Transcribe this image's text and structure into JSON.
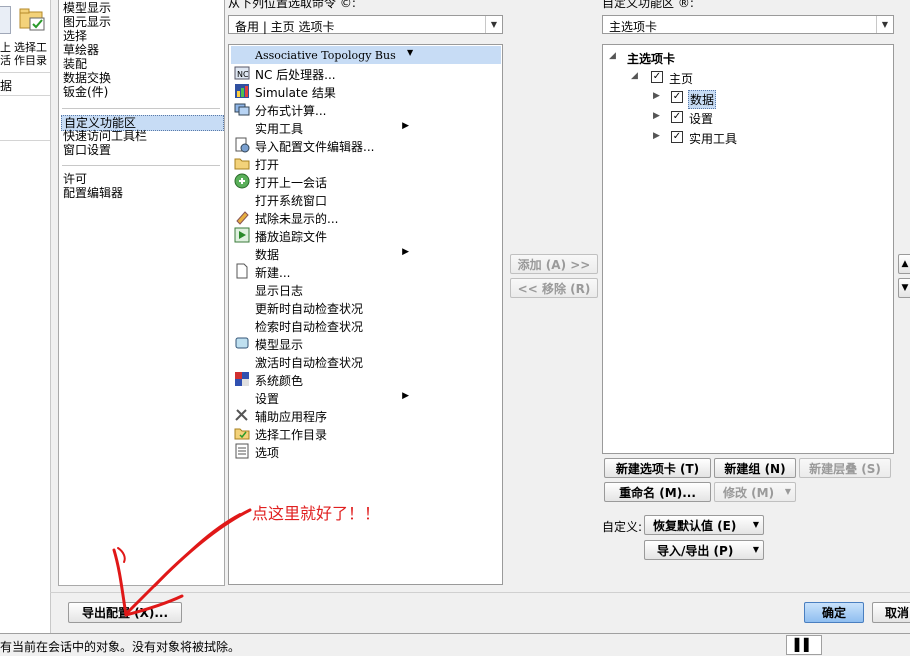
{
  "left_strip": {
    "toolbar_labels": [
      "上",
      "选择工",
      "活",
      "作目录"
    ],
    "row_label": "据"
  },
  "categories": {
    "items_top": [
      "模型显示",
      "图元显示",
      "选择",
      "草绘器",
      "装配",
      "数据交换",
      "钣金(件)"
    ],
    "items_mid": [
      "自定义功能区",
      "快速访问工具栏",
      "窗口设置"
    ],
    "items_bottom": [
      "许可",
      "配置编辑器"
    ]
  },
  "commands_from": {
    "label": "从下列位置选取命令 ©:",
    "value": "备用 | 主页 选项卡",
    "header": "Associative Topology Bus",
    "items": [
      {
        "label": "NC 后处理器...",
        "icon": "nc-postprocessor-icon",
        "submenu": false
      },
      {
        "label": "Simulate 结果",
        "icon": "simulate-results-icon",
        "submenu": false
      },
      {
        "label": "分布式计算...",
        "icon": "distributed-compute-icon",
        "submenu": false
      },
      {
        "label": "实用工具",
        "icon": "",
        "submenu": true
      },
      {
        "label": "导入配置文件编辑器...",
        "icon": "import-config-icon",
        "submenu": false
      },
      {
        "label": "打开",
        "icon": "open-folder-icon",
        "submenu": false
      },
      {
        "label": "打开上一会话",
        "icon": "open-last-session-icon",
        "submenu": false
      },
      {
        "label": "打开系统窗口",
        "icon": "",
        "submenu": false
      },
      {
        "label": "拭除未显示的...",
        "icon": "erase-not-displayed-icon",
        "submenu": false
      },
      {
        "label": "播放追踪文件",
        "icon": "play-trail-icon",
        "submenu": false
      },
      {
        "label": "数据",
        "icon": "",
        "submenu": true
      },
      {
        "label": "新建...",
        "icon": "new-document-icon",
        "submenu": false
      },
      {
        "label": "显示日志",
        "icon": "",
        "submenu": false
      },
      {
        "label": "更新时自动检查状况",
        "icon": "",
        "submenu": false
      },
      {
        "label": "检索时自动检查状况",
        "icon": "",
        "submenu": false
      },
      {
        "label": "模型显示",
        "icon": "model-display-icon",
        "submenu": false
      },
      {
        "label": "激活时自动检查状况",
        "icon": "",
        "submenu": false
      },
      {
        "label": "系统颜色",
        "icon": "system-colors-icon",
        "submenu": false
      },
      {
        "label": "设置",
        "icon": "",
        "submenu": true
      },
      {
        "label": "辅助应用程序",
        "icon": "auxiliary-apps-icon",
        "submenu": false
      },
      {
        "label": "选择工作目录",
        "icon": "select-working-dir-icon",
        "submenu": false
      },
      {
        "label": "选项",
        "icon": "options-icon",
        "submenu": false
      }
    ]
  },
  "transfer": {
    "add_label": "添加 (A) >>",
    "remove_label": "<< 移除 (R)"
  },
  "ribbon": {
    "label": "自定义功能区 ®:",
    "value": "主选项卡",
    "tree": [
      {
        "label": "主选项卡",
        "level": 0,
        "checkbox": false,
        "highlight": false
      },
      {
        "label": "主页",
        "level": 1,
        "checkbox": true,
        "highlight": false
      },
      {
        "label": "数据",
        "level": 2,
        "checkbox": true,
        "highlight": true
      },
      {
        "label": "设置",
        "level": 2,
        "checkbox": true,
        "highlight": false
      },
      {
        "label": "实用工具",
        "level": 2,
        "checkbox": true,
        "highlight": false
      }
    ],
    "new_tab_label": "新建选项卡 (T)",
    "new_group_label": "新建组 (N)",
    "new_cascade_label": "新建层叠 (S)",
    "rename_label": "重命名 (M)...",
    "modify_label": "修改 (M)",
    "customize_label": "自定义:",
    "restore_label": "恢复默认值 (E)",
    "import_export_label": "导入/导出 (P)"
  },
  "annotation": {
    "text": "点这里就好了！！",
    "color": "#e02020"
  },
  "footer": {
    "export_label": "导出配置 (X)...",
    "ok_label": "确定",
    "cancel_label": "取消",
    "status": "有当前在会话中的对象。没有对象将被拭除。"
  },
  "colors": {
    "selection": "#c7dcf5",
    "primary_button": "#8fbef0"
  }
}
